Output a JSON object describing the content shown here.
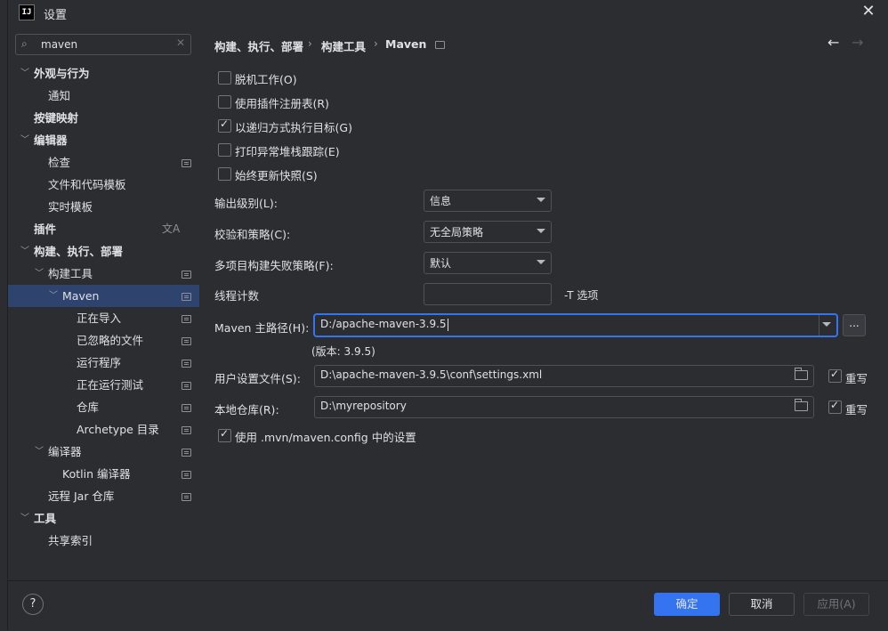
{
  "window": {
    "title": "设置",
    "app_logo": "IJ"
  },
  "search": {
    "value": "maven"
  },
  "sidebar": {
    "items": [
      {
        "label": "外观与行为",
        "bold": true
      },
      {
        "label": "通知"
      },
      {
        "label": "按键映射",
        "bold": true
      },
      {
        "label": "编辑器",
        "bold": true
      },
      {
        "label": "检查"
      },
      {
        "label": "文件和代码模板"
      },
      {
        "label": "实时模板"
      },
      {
        "label": "插件",
        "bold": true
      },
      {
        "label": "构建、执行、部署",
        "bold": true
      },
      {
        "label": "构建工具"
      },
      {
        "label": "Maven"
      },
      {
        "label": "正在导入"
      },
      {
        "label": "已忽略的文件"
      },
      {
        "label": "运行程序"
      },
      {
        "label": "正在运行测试"
      },
      {
        "label": "仓库"
      },
      {
        "label": "Archetype 目录"
      },
      {
        "label": "编译器"
      },
      {
        "label": "Kotlin 编译器"
      },
      {
        "label": "远程 Jar 仓库"
      },
      {
        "label": "工具",
        "bold": true
      },
      {
        "label": "共享索引"
      }
    ]
  },
  "breadcrumb": {
    "items": [
      "构建、执行、部署",
      "构建工具",
      "Maven"
    ]
  },
  "options": {
    "offline": "脱机工作(O)",
    "plugin_registry": "使用插件注册表(R)",
    "recursive": "以递归方式执行目标(G)",
    "print_stack": "打印异常堆栈跟踪(E)",
    "always_update": "始终更新快照(S)"
  },
  "fields": {
    "output_level_label": "输出级别(L):",
    "output_level_value": "信息",
    "checksum_label": "校验和策略(C):",
    "checksum_value": "无全局策略",
    "multiproject_label": "多项目构建失败策略(F):",
    "multiproject_value": "默认",
    "thread_label": "线程计数",
    "thread_hint": "-T 选项",
    "maven_home_label": "Maven 主路径(H):",
    "maven_home_value": "D:/apache-maven-3.9.5",
    "browse_label": "...",
    "version": "(版本: 3.9.5)",
    "user_settings_label": "用户设置文件(S):",
    "user_settings_value": "D:\\apache-maven-3.9.5\\conf\\settings.xml",
    "override_label": "重写",
    "local_repo_label": "本地仓库(R):",
    "local_repo_value": "D:\\myrepository",
    "override_label2": "重写",
    "mvn_config": "使用 .mvn/maven.config 中的设置"
  },
  "footer": {
    "help": "?",
    "ok": "确定",
    "cancel": "取消",
    "apply": "应用(A)"
  }
}
